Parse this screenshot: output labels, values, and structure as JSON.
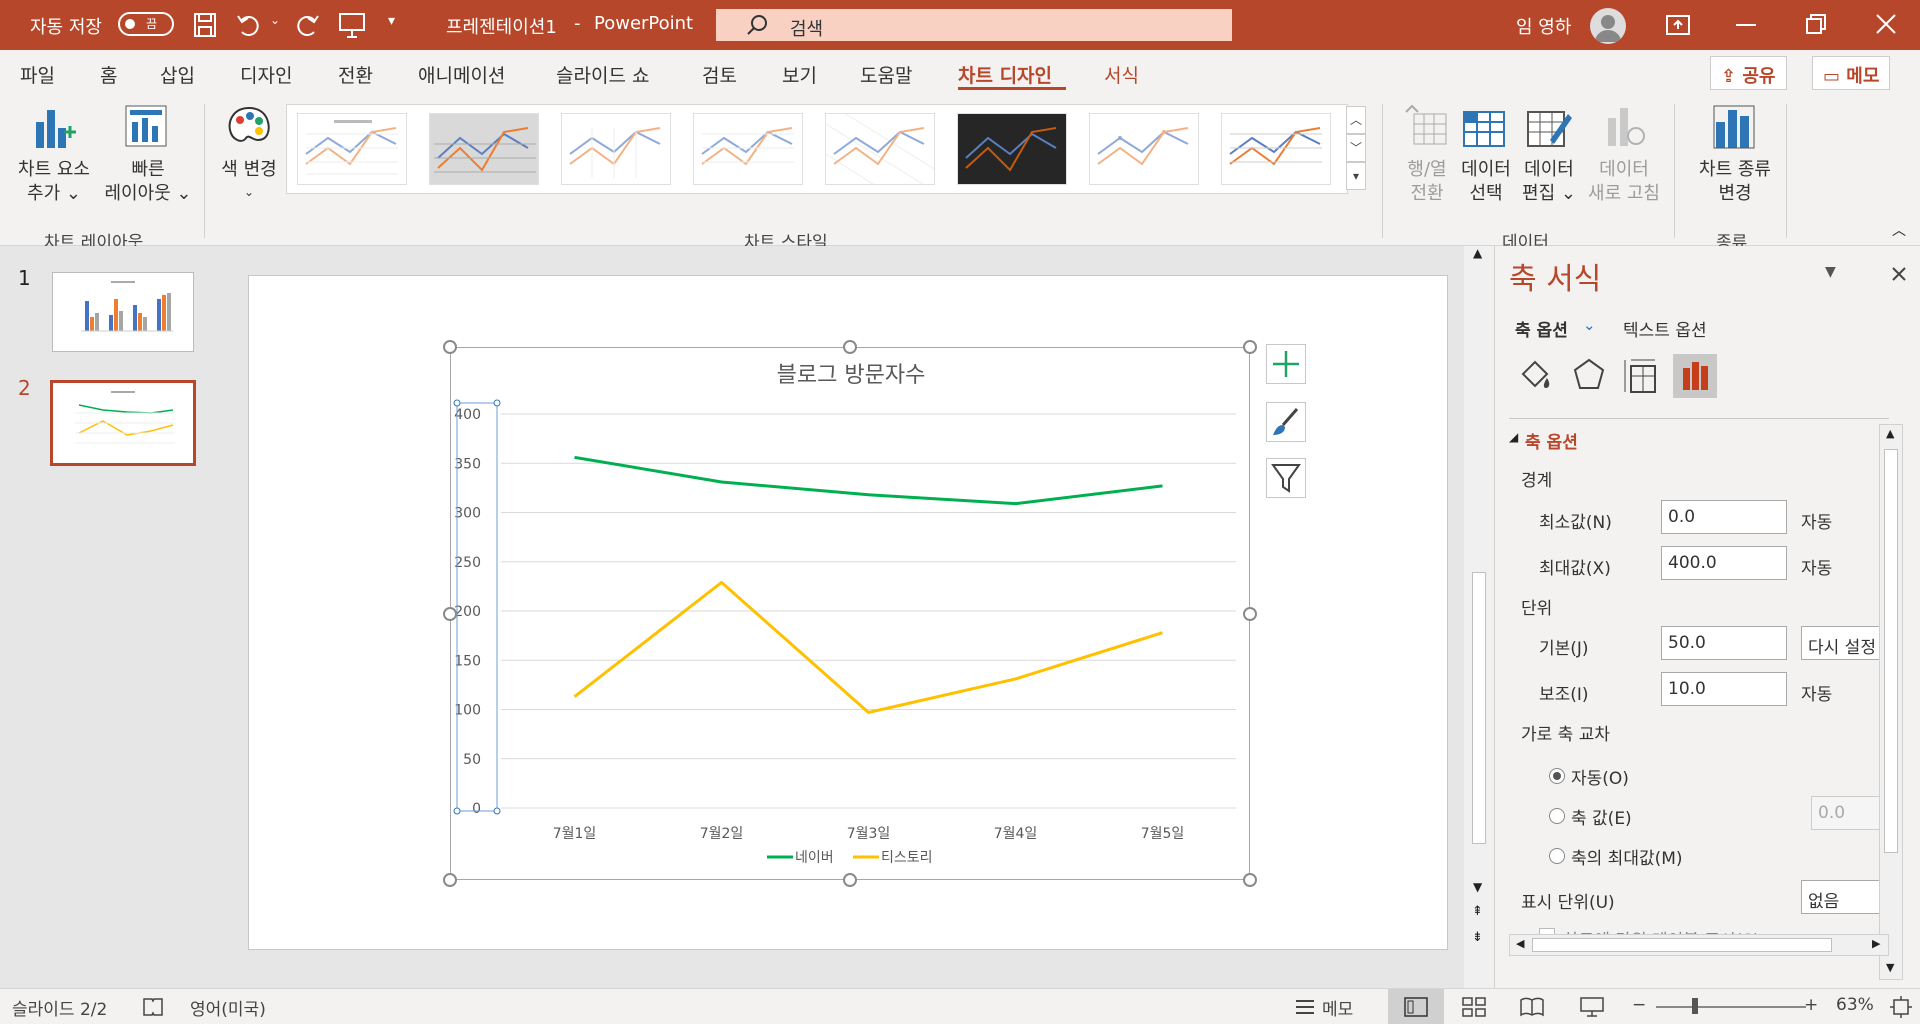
{
  "titlebar": {
    "autosave_label": "자동 저장",
    "autosave_state": "끔",
    "doc_title": "프레젠테이션1",
    "sep": "-",
    "app_name": "PowerPoint",
    "search_placeholder": "검색",
    "user_name": "임 영하"
  },
  "tabs": [
    "파일",
    "홈",
    "삽입",
    "디자인",
    "전환",
    "애니메이션",
    "슬라이드 쇼",
    "검토",
    "보기",
    "도움말",
    "차트 디자인",
    "서식"
  ],
  "tab_active": "차트 디자인",
  "share_label": "공유",
  "comment_label": "메모",
  "ribbon": {
    "add_element": [
      "차트 요소",
      "추가 ⌄"
    ],
    "quick_layout": [
      "빠른",
      "레이아웃 ⌄"
    ],
    "group_layout": "차트 레이아웃",
    "change_color": [
      "색 변경",
      "⌄"
    ],
    "group_styles": "차트 스타일",
    "switch_rowcol": [
      "행/열",
      "전환"
    ],
    "select_data": [
      "데이터",
      "선택"
    ],
    "edit_data": [
      "데이터",
      "편집 ⌄"
    ],
    "refresh_data": [
      "데이터",
      "새로 고침"
    ],
    "group_data": "데이터",
    "change_type": [
      "차트 종류",
      "변경"
    ],
    "group_type": "종류"
  },
  "slides": {
    "numbers": [
      "1",
      "2"
    ],
    "active": 2
  },
  "chart_data": {
    "type": "line",
    "title": "블로그 방문자수",
    "categories": [
      "7월1일",
      "7월2일",
      "7월3일",
      "7월4일",
      "7월5일"
    ],
    "series": [
      {
        "name": "네이버",
        "values": [
          356,
          331,
          318,
          309,
          327
        ],
        "color": "#00b050"
      },
      {
        "name": "티스토리",
        "values": [
          113,
          229,
          97,
          131,
          178
        ],
        "color": "#ffc000"
      }
    ],
    "yticks": [
      "0",
      "50",
      "100",
      "150",
      "200",
      "250",
      "300",
      "350",
      "400"
    ],
    "ylim": [
      0,
      400
    ],
    "grid": true,
    "legend": "bottom"
  },
  "pane": {
    "title": "축 서식",
    "tab_axis_options": "축 옵션",
    "tab_text_options": "텍스트 옵션",
    "section": "축 옵션",
    "bounds": "경계",
    "min_label": "최소값(N)",
    "min_value": "0.0",
    "min_auto": "자동",
    "max_label": "최대값(X)",
    "max_value": "400.0",
    "max_auto": "자동",
    "units": "단위",
    "major_label": "기본(J)",
    "major_value": "50.0",
    "major_reset": "다시 설정",
    "minor_label": "보조(I)",
    "minor_value": "10.0",
    "minor_auto": "자동",
    "crosses": "가로 축 교차",
    "crosses_auto": "자동(O)",
    "crosses_value": "축 값(E)",
    "crosses_value_input": "0.0",
    "crosses_max": "축의 최대값(M)",
    "display_units_label": "표시 단위(U)",
    "display_units_value": "없음",
    "show_units_label": "차트에 단위 레이블 표시(S)"
  },
  "status": {
    "slide_info": "슬라이드 2/2",
    "language": "영어(미국)",
    "notes": "메모",
    "zoom": "63%"
  },
  "colors": {
    "accent": "#b7472a",
    "naver": "#00b050",
    "tistory": "#ffc000"
  }
}
